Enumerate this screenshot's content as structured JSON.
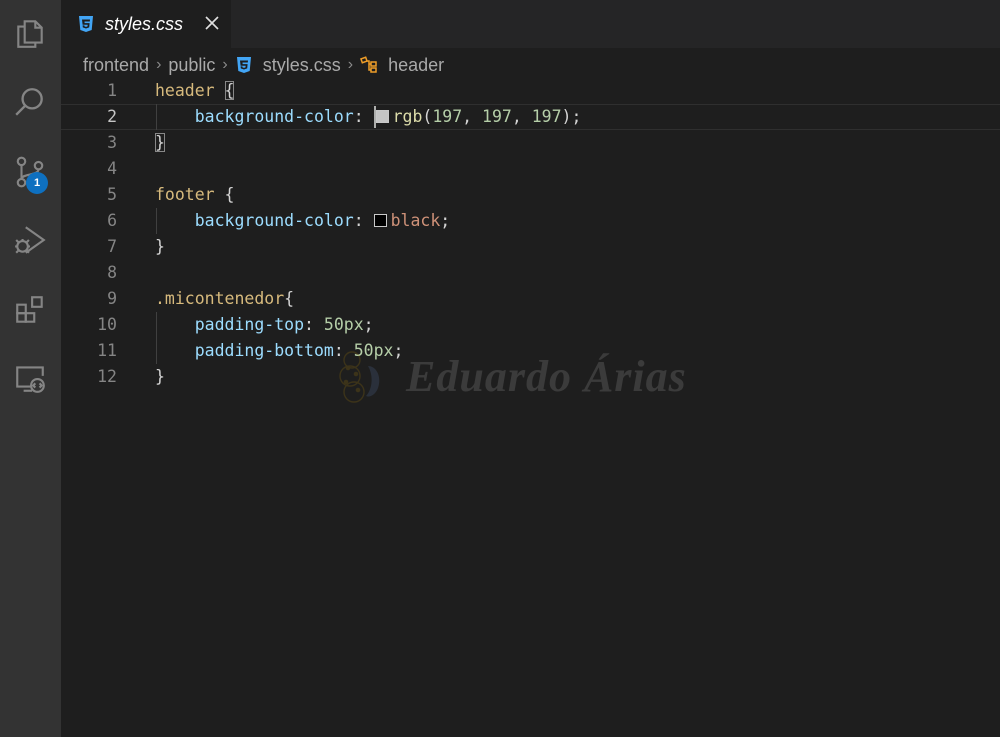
{
  "activity_bar": {
    "items": [
      {
        "name": "explorer",
        "icon": "files-icon"
      },
      {
        "name": "search",
        "icon": "search-icon"
      },
      {
        "name": "source-control",
        "icon": "source-control-icon",
        "badge": "1"
      },
      {
        "name": "run-debug",
        "icon": "run-debug-icon"
      },
      {
        "name": "extensions",
        "icon": "extensions-icon"
      },
      {
        "name": "remote-explorer",
        "icon": "remote-explorer-icon"
      }
    ],
    "badge_color": "#0e70c0"
  },
  "tab": {
    "label": "styles.css",
    "icon": "css-file-icon",
    "close_icon": "close-icon"
  },
  "breadcrumb": {
    "items": [
      "frontend",
      "public",
      "styles.css",
      "header"
    ],
    "file_icon": "css-file-icon",
    "symbol_icon": "symbol-class-icon"
  },
  "editor": {
    "active_line": 2,
    "lines": [
      {
        "n": "1",
        "tokens": [
          [
            "sel",
            "header"
          ],
          [
            "punc",
            " "
          ],
          [
            "bracket",
            "{"
          ]
        ]
      },
      {
        "n": "2",
        "tokens": [
          [
            "indent",
            "    "
          ],
          [
            "prop",
            "background-color"
          ],
          [
            "punc",
            ": "
          ],
          [
            "cursor",
            ""
          ],
          [
            "swatch",
            "#c5c5c5"
          ],
          [
            "fn",
            "rgb"
          ],
          [
            "punc",
            "("
          ],
          [
            "num",
            "197"
          ],
          [
            "punc",
            ", "
          ],
          [
            "num",
            "197"
          ],
          [
            "punc",
            ", "
          ],
          [
            "num",
            "197"
          ],
          [
            "punc",
            ");"
          ]
        ]
      },
      {
        "n": "3",
        "tokens": [
          [
            "bracket",
            "}"
          ]
        ]
      },
      {
        "n": "4",
        "tokens": []
      },
      {
        "n": "5",
        "tokens": [
          [
            "sel",
            "footer"
          ],
          [
            "punc",
            " {"
          ]
        ]
      },
      {
        "n": "6",
        "tokens": [
          [
            "indent",
            "    "
          ],
          [
            "prop",
            "background-color"
          ],
          [
            "punc",
            ": "
          ],
          [
            "swatch",
            "#000000"
          ],
          [
            "val",
            "black"
          ],
          [
            "punc",
            ";"
          ]
        ]
      },
      {
        "n": "7",
        "tokens": [
          [
            "punc",
            "}"
          ]
        ]
      },
      {
        "n": "8",
        "tokens": []
      },
      {
        "n": "9",
        "tokens": [
          [
            "sel",
            ".micontenedor"
          ],
          [
            "punc",
            "{"
          ]
        ]
      },
      {
        "n": "10",
        "tokens": [
          [
            "indent",
            "    "
          ],
          [
            "prop",
            "padding-top"
          ],
          [
            "punc",
            ": "
          ],
          [
            "num",
            "50px"
          ],
          [
            "punc",
            ";"
          ]
        ]
      },
      {
        "n": "11",
        "tokens": [
          [
            "indent",
            "    "
          ],
          [
            "prop",
            "padding-bottom"
          ],
          [
            "punc",
            ": "
          ],
          [
            "num",
            "50px"
          ],
          [
            "punc",
            ";"
          ]
        ]
      },
      {
        "n": "12",
        "tokens": [
          [
            "punc",
            "}"
          ]
        ]
      }
    ]
  },
  "watermark": {
    "text": "Eduardo Árias"
  },
  "colors": {
    "selector": "#d7ba7d",
    "property": "#9cdcfe",
    "number": "#b5cea8",
    "function": "#dcdcaa",
    "string_value": "#ce9178",
    "css_icon": "#42a5f5"
  }
}
